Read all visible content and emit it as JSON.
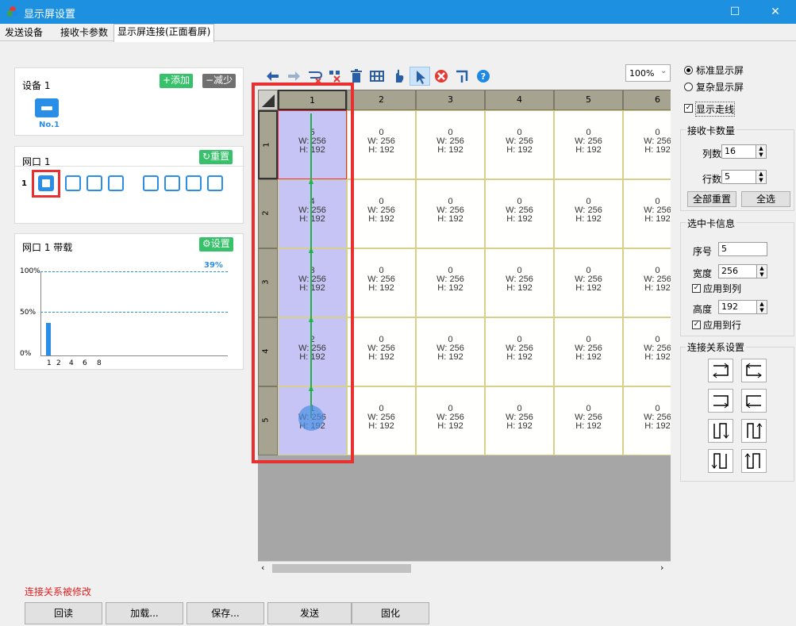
{
  "window": {
    "title": "显示屏设置",
    "maximize_glyph": "☐",
    "close_glyph": "✕"
  },
  "tabs": [
    "发送设备",
    "接收卡参数",
    "显示屏连接(正面看屏)"
  ],
  "device_panel": {
    "title": "设备 1",
    "add_label": "添加",
    "remove_label": "减少",
    "device_label": "No.1"
  },
  "port_panel": {
    "title": "网口 1",
    "reset_label": "重置",
    "port_index": "1"
  },
  "load_panel": {
    "title": "网口 1 带载",
    "settings_label": "设置",
    "percent_label": "39%",
    "y_ticks": [
      "100%",
      "50%",
      "0%"
    ],
    "x_ticks": [
      "1",
      "2",
      "4",
      "6",
      "8"
    ]
  },
  "toolbar": {
    "zoom": "100%",
    "zoom_arrow": "⌄"
  },
  "grid": {
    "col_headers": [
      "1",
      "2",
      "3",
      "4",
      "5",
      "6"
    ],
    "row_headers": [
      "1",
      "2",
      "3",
      "4",
      "5"
    ],
    "rows": [
      [
        {
          "n": "5",
          "w": "W: 256",
          "h": "H: 192"
        },
        {
          "n": "0",
          "w": "W: 256",
          "h": "H: 192"
        },
        {
          "n": "0",
          "w": "W: 256",
          "h": "H: 192"
        },
        {
          "n": "0",
          "w": "W: 256",
          "h": "H: 192"
        },
        {
          "n": "0",
          "w": "W: 256",
          "h": "H: 192"
        },
        {
          "n": "0",
          "w": "W: 256",
          "h": "H: 192"
        }
      ],
      [
        {
          "n": "4",
          "w": "W: 256",
          "h": "H: 192"
        },
        {
          "n": "0",
          "w": "W: 256",
          "h": "H: 192"
        },
        {
          "n": "0",
          "w": "W: 256",
          "h": "H: 192"
        },
        {
          "n": "0",
          "w": "W: 256",
          "h": "H: 192"
        },
        {
          "n": "0",
          "w": "W: 256",
          "h": "H: 192"
        },
        {
          "n": "0",
          "w": "W: 256",
          "h": "H: 192"
        }
      ],
      [
        {
          "n": "3",
          "w": "W: 256",
          "h": "H: 192"
        },
        {
          "n": "0",
          "w": "W: 256",
          "h": "H: 192"
        },
        {
          "n": "0",
          "w": "W: 256",
          "h": "H: 192"
        },
        {
          "n": "0",
          "w": "W: 256",
          "h": "H: 192"
        },
        {
          "n": "0",
          "w": "W: 256",
          "h": "H: 192"
        },
        {
          "n": "0",
          "w": "W: 256",
          "h": "H: 192"
        }
      ],
      [
        {
          "n": "2",
          "w": "W: 256",
          "h": "H: 192"
        },
        {
          "n": "0",
          "w": "W: 256",
          "h": "H: 192"
        },
        {
          "n": "0",
          "w": "W: 256",
          "h": "H: 192"
        },
        {
          "n": "0",
          "w": "W: 256",
          "h": "H: 192"
        },
        {
          "n": "0",
          "w": "W: 256",
          "h": "H: 192"
        },
        {
          "n": "0",
          "w": "W: 256",
          "h": "H: 192"
        }
      ],
      [
        {
          "n": "1",
          "w": "W: 256",
          "h": "H: 192"
        },
        {
          "n": "0",
          "w": "W: 256",
          "h": "H: 192"
        },
        {
          "n": "0",
          "w": "W: 256",
          "h": "H: 192"
        },
        {
          "n": "0",
          "w": "W: 256",
          "h": "H: 192"
        },
        {
          "n": "0",
          "w": "W: 256",
          "h": "H: 192"
        },
        {
          "n": "0",
          "w": "W: 256",
          "h": "H: 192"
        }
      ]
    ]
  },
  "right": {
    "standard_label": "标准显示屏",
    "complex_label": "复杂显示屏",
    "show_wiring_label": "显示走线",
    "count_group": "接收卡数量",
    "cols_label": "列数",
    "cols_value": "16",
    "rows_label": "行数",
    "rows_value": "5",
    "reset_all": "全部重置",
    "select_all": "全选",
    "sel_group": "选中卡信息",
    "index_label": "序号",
    "index_value": "5",
    "width_label": "宽度",
    "width_value": "256",
    "apply_col": "应用到列",
    "height_label": "高度",
    "height_value": "192",
    "apply_row": "应用到行",
    "conn_group": "连接关系设置"
  },
  "status": {
    "message": "连接关系被修改",
    "color": "#e02020"
  },
  "bottom": {
    "readback": "回读",
    "load": "加载...",
    "save": "保存...",
    "send": "发送",
    "solidify": "固化"
  },
  "colors": {
    "accent": "#1e90e0",
    "green": "#37c16a",
    "highlight": "#e83030",
    "selected": "#c6c4f4"
  }
}
